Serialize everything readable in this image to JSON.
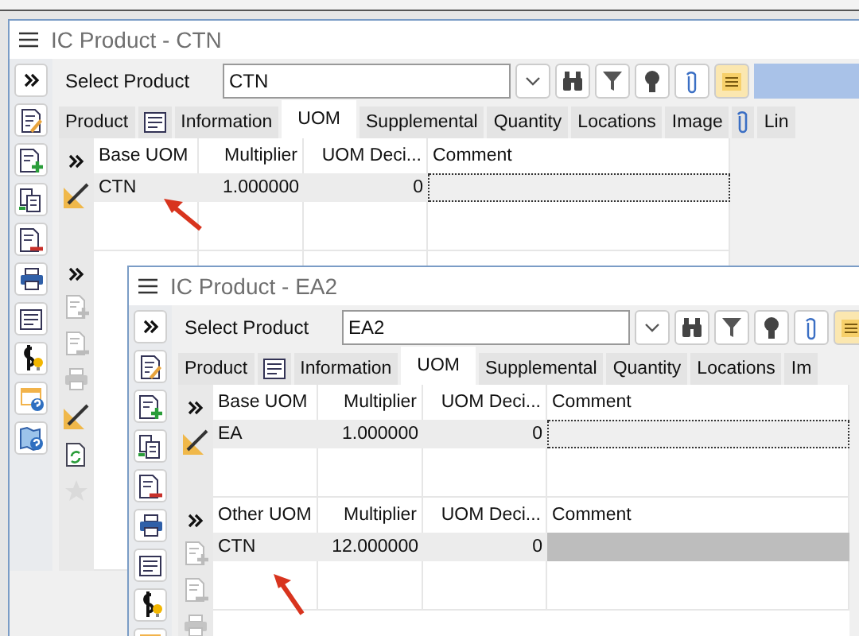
{
  "windows": [
    {
      "title": "IC Product - CTN",
      "select_label": "Select Product",
      "product": "CTN",
      "tabs": [
        {
          "label": "Product",
          "kind": "plain",
          "selected": false
        },
        {
          "label": "Information",
          "kind": "list",
          "selected": false
        },
        {
          "label": "UOM",
          "kind": "plain",
          "selected": true
        },
        {
          "label": "Supplemental",
          "kind": "plain",
          "selected": false
        },
        {
          "label": "Quantity",
          "kind": "plain",
          "selected": false
        },
        {
          "label": "Locations",
          "kind": "plain",
          "selected": false
        },
        {
          "label": "Image",
          "kind": "plain",
          "selected": false
        },
        {
          "label": "Lin",
          "kind": "attachment",
          "selected": false
        }
      ],
      "sections": [
        {
          "columns": [
            "Base UOM",
            "Multiplier",
            "UOM Deci...",
            "Comment"
          ],
          "rows": [
            {
              "cells": [
                "CTN",
                "1.000000",
                "0"
              ],
              "comment_focused": true,
              "comment_selected": false
            }
          ]
        }
      ]
    },
    {
      "title": "IC Product - EA2",
      "select_label": "Select Product",
      "product": "EA2",
      "tabs": [
        {
          "label": "Product",
          "kind": "plain",
          "selected": false
        },
        {
          "label": "Information",
          "kind": "list",
          "selected": false
        },
        {
          "label": "UOM",
          "kind": "plain",
          "selected": true
        },
        {
          "label": "Supplemental",
          "kind": "plain",
          "selected": false
        },
        {
          "label": "Quantity",
          "kind": "plain",
          "selected": false
        },
        {
          "label": "Locations",
          "kind": "plain",
          "selected": false
        },
        {
          "label": "Im",
          "kind": "plain",
          "selected": false
        }
      ],
      "sections": [
        {
          "columns": [
            "Base UOM",
            "Multiplier",
            "UOM Deci...",
            "Comment"
          ],
          "rows": [
            {
              "cells": [
                "EA",
                "1.000000",
                "0"
              ],
              "comment_focused": true,
              "comment_selected": false
            }
          ]
        },
        {
          "columns": [
            "Other UOM",
            "Multiplier",
            "UOM Deci...",
            "Comment"
          ],
          "rows": [
            {
              "cells": [
                "CTN",
                "12.000000",
                "0"
              ],
              "comment_focused": false,
              "comment_selected": true
            }
          ]
        }
      ]
    }
  ]
}
